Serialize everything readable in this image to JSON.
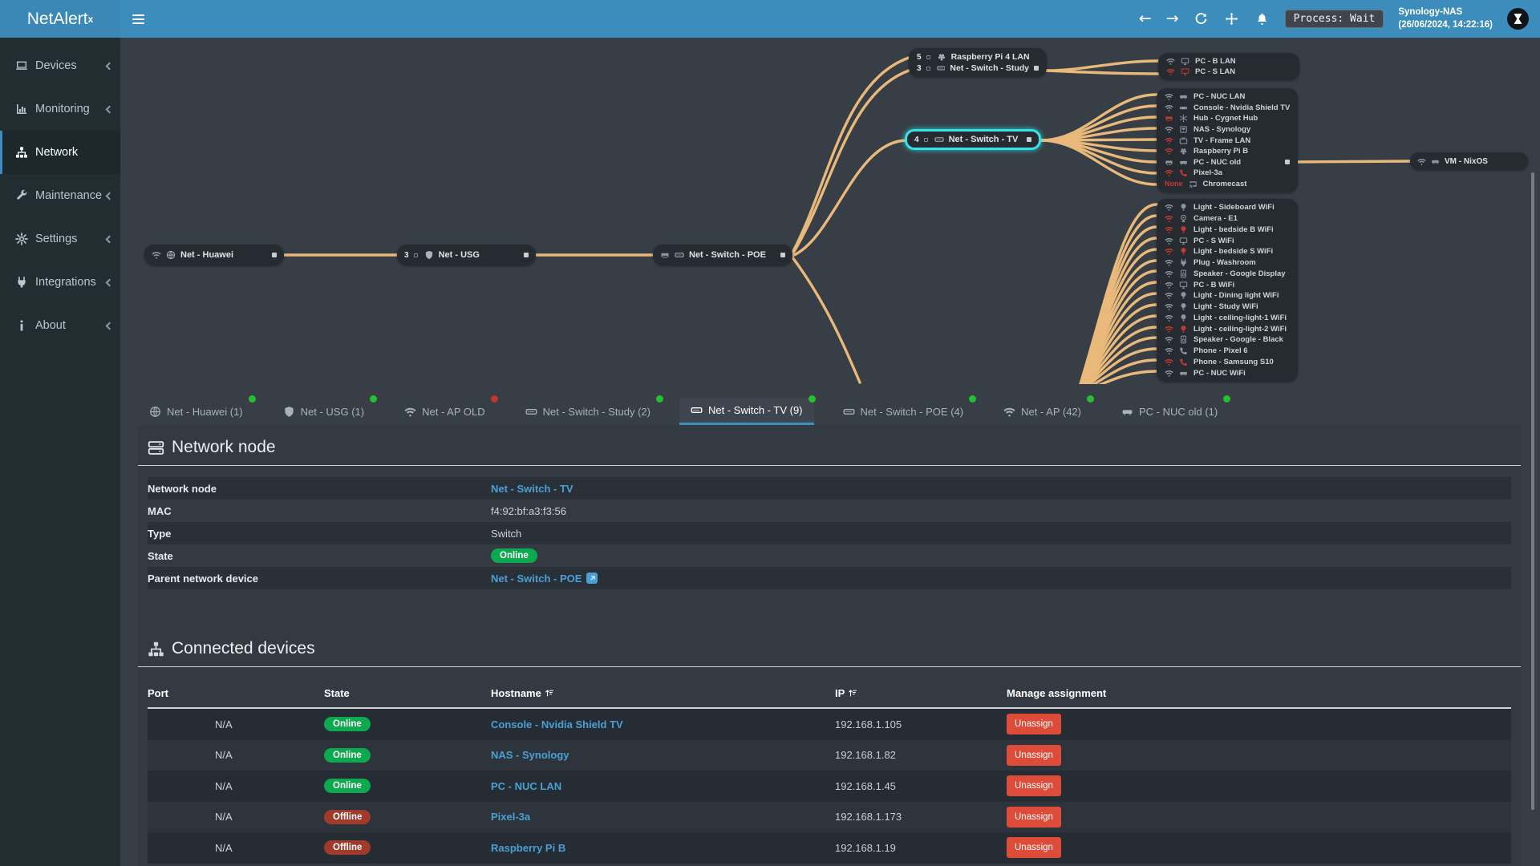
{
  "brand": {
    "name": "NetAlert",
    "sup": "x"
  },
  "topbar": {
    "back": "←",
    "forward": "→",
    "process_label": "Process: Wait",
    "host": "Synology-NAS",
    "timestamp": "(26/06/2024, 14:22:16)"
  },
  "sidebar": {
    "items": [
      {
        "icon": "laptop-icon",
        "label": "Devices",
        "chevron": true,
        "active": false
      },
      {
        "icon": "chart-icon",
        "label": "Monitoring",
        "chevron": true,
        "active": false
      },
      {
        "icon": "sitemap-icon",
        "label": "Network",
        "chevron": false,
        "active": true
      },
      {
        "icon": "wrench-icon",
        "label": "Maintenance",
        "chevron": true,
        "active": false
      },
      {
        "icon": "gear-icon",
        "label": "Settings",
        "chevron": true,
        "active": false
      },
      {
        "icon": "plug-icon",
        "label": "Integrations",
        "chevron": true,
        "active": false
      },
      {
        "icon": "info-icon",
        "label": "About",
        "chevron": true,
        "active": false
      }
    ]
  },
  "diagram": {
    "link_color": "#f2c07d",
    "selected_color": "#35e4e8",
    "huawei": {
      "label": "Net - Huawei"
    },
    "usg": {
      "count": "3",
      "label": "Net - USG"
    },
    "poe": {
      "label": "Net - Switch - POE"
    },
    "tv": {
      "count": "4",
      "label": "Net - Switch - TV"
    },
    "vm": {
      "label": "VM - NixOS"
    },
    "study_rows": [
      {
        "count": "5",
        "icon": "raspberry-icon",
        "icon_color": "lite",
        "label": "Raspberry Pi 4 LAN"
      },
      {
        "count": "3",
        "icon": "switch-icon",
        "icon_color": "lite",
        "label": "Net - Switch - Study",
        "port": true
      }
    ],
    "group1": [
      {
        "conn": "wifi-icon",
        "conn_color": "gray",
        "icon": "monitor-icon",
        "icon_color": "gray",
        "label": "PC - B LAN"
      },
      {
        "conn": "wifi-icon",
        "conn_color": "red",
        "icon": "monitor-icon",
        "icon_color": "red",
        "label": "PC - S LAN"
      }
    ],
    "group2": [
      {
        "conn": "wifi-icon",
        "conn_color": "gray",
        "icon": "nuc-icon",
        "icon_color": "gray",
        "label": "PC - NUC LAN"
      },
      {
        "conn": "wifi-icon",
        "conn_color": "gray",
        "icon": "console-icon",
        "icon_color": "gray",
        "label": "Console - Nvidia Shield TV"
      },
      {
        "conn": "eth-icon",
        "conn_color": "red",
        "icon": "hub-icon",
        "icon_color": "gray",
        "label": "Hub - Cygnet Hub"
      },
      {
        "conn": "wifi-icon",
        "conn_color": "gray",
        "icon": "nas-icon",
        "icon_color": "gray",
        "label": "NAS - Synology"
      },
      {
        "conn": "wifi-icon",
        "conn_color": "red",
        "icon": "tv-icon",
        "icon_color": "gray",
        "label": "TV - Frame LAN"
      },
      {
        "conn": "wifi-icon",
        "conn_color": "red",
        "icon": "raspberry-icon",
        "icon_color": "gray",
        "label": "Raspberry Pi B"
      },
      {
        "conn": "eth-icon",
        "conn_color": "gray",
        "icon": "nuc-icon",
        "icon_color": "gray",
        "label": "PC - NUC old",
        "port": true
      },
      {
        "conn": "wifi-icon",
        "conn_color": "red",
        "icon": "phone-icon",
        "icon_color": "red",
        "label": "Pixel-3a"
      },
      {
        "conn_text": "None",
        "icon": "cast-icon",
        "icon_color": "gray",
        "label": "Chromecast"
      }
    ],
    "group3": [
      {
        "conn": "wifi-icon",
        "conn_color": "gray",
        "icon": "bulb-icon",
        "icon_color": "gray",
        "label": "Light - Sideboard WiFi"
      },
      {
        "conn": "wifi-icon",
        "conn_color": "red",
        "icon": "camera-icon",
        "icon_color": "gray",
        "label": "Camera - E1"
      },
      {
        "conn": "wifi-icon",
        "conn_color": "red",
        "icon": "bulb-icon",
        "icon_color": "red",
        "label": "Light - bedside B WiFi"
      },
      {
        "conn": "wifi-icon",
        "conn_color": "gray",
        "icon": "monitor-icon",
        "icon_color": "gray",
        "label": "PC - S WiFi"
      },
      {
        "conn": "wifi-icon",
        "conn_color": "red",
        "icon": "bulb-icon",
        "icon_color": "red",
        "label": "Light - bedside S WiFi"
      },
      {
        "conn": "wifi-icon",
        "conn_color": "gray",
        "icon": "plug-icon",
        "icon_color": "gray",
        "label": "Plug - Washroom"
      },
      {
        "conn": "wifi-icon",
        "conn_color": "gray",
        "icon": "speaker-icon",
        "icon_color": "gray",
        "label": "Speaker - Google Display"
      },
      {
        "conn": "wifi-icon",
        "conn_color": "gray",
        "icon": "monitor-icon",
        "icon_color": "gray",
        "label": "PC - B WiFi"
      },
      {
        "conn": "wifi-icon",
        "conn_color": "gray",
        "icon": "bulb-icon",
        "icon_color": "gray",
        "label": "Light - Dining light WiFi"
      },
      {
        "conn": "wifi-icon",
        "conn_color": "gray",
        "icon": "bulb-icon",
        "icon_color": "gray",
        "label": "Light - Study WiFi"
      },
      {
        "conn": "wifi-icon",
        "conn_color": "gray",
        "icon": "bulb-icon",
        "icon_color": "gray",
        "label": "Light - ceiling-light-1 WiFi"
      },
      {
        "conn": "wifi-icon",
        "conn_color": "red",
        "icon": "bulb-icon",
        "icon_color": "red",
        "label": "Light - ceiling-light-2 WiFi"
      },
      {
        "conn": "wifi-icon",
        "conn_color": "gray",
        "icon": "speaker-icon",
        "icon_color": "gray",
        "label": "Speaker - Google - Black"
      },
      {
        "conn": "wifi-icon",
        "conn_color": "gray",
        "icon": "phone-icon",
        "icon_color": "gray",
        "label": "Phone - Pixel 6"
      },
      {
        "conn": "wifi-icon",
        "conn_color": "red",
        "icon": "phone-icon",
        "icon_color": "red",
        "label": "Phone - Samsung S10"
      },
      {
        "conn": "wifi-icon",
        "conn_color": "gray",
        "icon": "nuc-icon",
        "icon_color": "gray",
        "label": "PC - NUC WiFi"
      }
    ]
  },
  "tabs": [
    {
      "icon": "globe-icon",
      "label": "Net - Huawei (1)",
      "dot": "green",
      "active": false
    },
    {
      "icon": "shield-icon",
      "label": "Net - USG (1)",
      "dot": "green",
      "active": false
    },
    {
      "icon": "wifi-icon",
      "label": "Net - AP OLD",
      "dot": "red",
      "active": false
    },
    {
      "icon": "switch-icon",
      "label": "Net - Switch - Study (2)",
      "dot": "green",
      "active": false
    },
    {
      "icon": "switch-icon",
      "label": "Net - Switch - TV (9)",
      "dot": "green",
      "active": true
    },
    {
      "icon": "switch-icon",
      "label": "Net - Switch - POE (4)",
      "dot": "green",
      "active": false
    },
    {
      "icon": "wifi-icon",
      "label": "Net - AP (42)",
      "dot": "green",
      "active": false
    },
    {
      "icon": "nuc-icon",
      "label": "PC - NUC old (1)",
      "dot": "green",
      "active": false
    }
  ],
  "network_node_section": {
    "title": "Network node",
    "rows": [
      {
        "label": "Network node",
        "link": "Net - Switch - TV"
      },
      {
        "label": "MAC",
        "text": "f4:92:bf:a3:f3:56"
      },
      {
        "label": "Type",
        "text": "Switch"
      },
      {
        "label": "State",
        "badge": "Online"
      },
      {
        "label": "Parent network device",
        "link": "Net - Switch - POE",
        "ext": true
      }
    ]
  },
  "connected_devices": {
    "title": "Connected devices",
    "columns": {
      "port": "Port",
      "state": "State",
      "hostname": "Hostname",
      "ip": "IP",
      "manage": "Manage assignment"
    },
    "rows": [
      {
        "port": "N/A",
        "state": "Online",
        "state_class": "online",
        "hostname": "Console - Nvidia Shield TV",
        "ip": "192.168.1.105",
        "action": "Unassign"
      },
      {
        "port": "N/A",
        "state": "Online",
        "state_class": "online",
        "hostname": "NAS - Synology",
        "ip": "192.168.1.82",
        "action": "Unassign"
      },
      {
        "port": "N/A",
        "state": "Online",
        "state_class": "online",
        "hostname": "PC - NUC LAN",
        "ip": "192.168.1.45",
        "action": "Unassign"
      },
      {
        "port": "N/A",
        "state": "Offline",
        "state_class": "offline",
        "hostname": "Pixel-3a",
        "ip": "192.168.1.173",
        "action": "Unassign"
      },
      {
        "port": "N/A",
        "state": "Offline",
        "state_class": "offline",
        "hostname": "Raspberry Pi B",
        "ip": "192.168.1.19",
        "action": "Unassign"
      }
    ]
  }
}
